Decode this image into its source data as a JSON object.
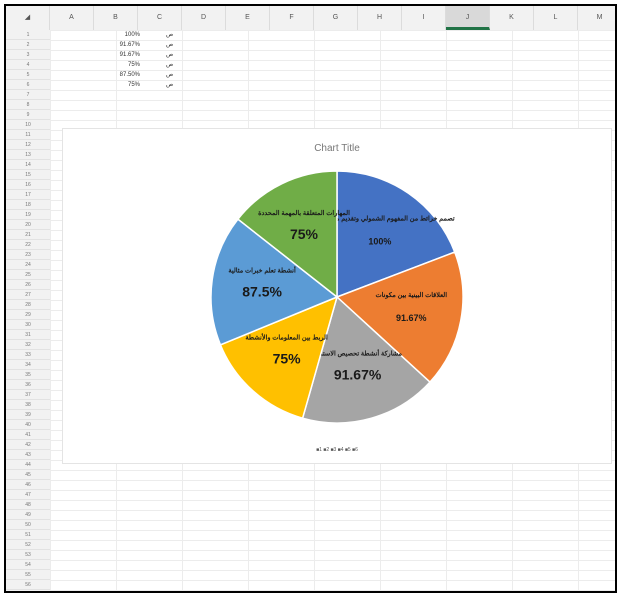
{
  "sheet": {
    "column_headers": [
      "A",
      "B",
      "C",
      "D",
      "E",
      "F",
      "G",
      "H",
      "I",
      "J",
      "K",
      "L",
      "M"
    ],
    "selected_column_index": 9,
    "row_headers": [
      "1",
      "2",
      "3",
      "4",
      "5",
      "6",
      "7",
      "8",
      "9",
      "10",
      "11",
      "12",
      "13",
      "14",
      "15",
      "16",
      "17",
      "18",
      "19",
      "20",
      "21",
      "22",
      "23",
      "24",
      "25",
      "26",
      "27",
      "28",
      "29",
      "30",
      "31",
      "32",
      "33",
      "34",
      "35",
      "36",
      "37",
      "38",
      "39",
      "40",
      "41",
      "42",
      "43",
      "44",
      "45",
      "46",
      "47",
      "48",
      "49",
      "50",
      "51",
      "52",
      "53",
      "54",
      "55",
      "56",
      "57"
    ],
    "rows": [
      {
        "pct": "100%",
        "label": "ص"
      },
      {
        "pct": "91.67%",
        "label": "ص"
      },
      {
        "pct": "91.67%",
        "label": "ص"
      },
      {
        "pct": "75%",
        "label": "ص"
      },
      {
        "pct": "87.50%",
        "label": "ص"
      },
      {
        "pct": "75%",
        "label": "ص"
      }
    ]
  },
  "chart_data": {
    "type": "pie",
    "title": "Chart Title",
    "legend_text": "■1 ■2 ■3 ■4 ■5 ■6",
    "legend_position": "bottom",
    "slices": [
      {
        "label": "تصمم خرائط من المفهوم الشمولي وتقديم ما يتم إعداده",
        "value": 100,
        "display": "100%",
        "color": "#4472c4"
      },
      {
        "label": "العلاقات البينية بين مكونات",
        "value": 91.67,
        "display": "91.67%",
        "color": "#ed7d31"
      },
      {
        "label": "مشاركة أنشطة تحصيص الاستماع",
        "value": 91.67,
        "display": "91.67%",
        "color": "#a5a5a5"
      },
      {
        "label": "الربط بين المعلومات والأنشطة",
        "value": 75,
        "display": "75%",
        "color": "#ffc000"
      },
      {
        "label": "أنشطة تعلم خبرات مثالية",
        "value": 87.5,
        "display": "87.5%",
        "color": "#5b9bd5"
      },
      {
        "label": "المهارات المتعلقة بالمهمة المحددة",
        "value": 75,
        "display": "75%",
        "color": "#70ad47"
      }
    ]
  }
}
